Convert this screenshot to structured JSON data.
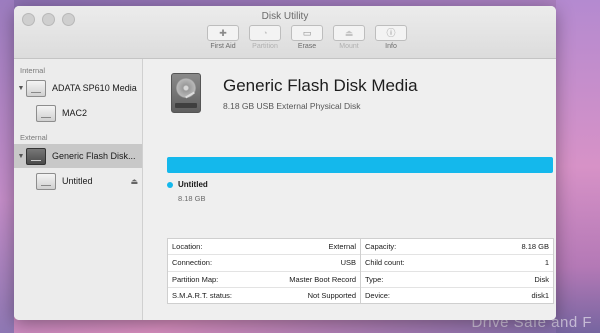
{
  "window": {
    "title": "Disk Utility"
  },
  "toolbar": [
    {
      "label": "First Aid",
      "icon": "stethoscope-icon",
      "glyph": "✚",
      "enabled": true
    },
    {
      "label": "Partition",
      "icon": "partition-icon",
      "glyph": "◔",
      "enabled": false
    },
    {
      "label": "Erase",
      "icon": "erase-icon",
      "glyph": "▭",
      "enabled": true
    },
    {
      "label": "Mount",
      "icon": "mount-icon",
      "glyph": "⏏",
      "enabled": false
    },
    {
      "label": "Info",
      "icon": "info-icon",
      "glyph": "ⓘ",
      "enabled": true
    }
  ],
  "sidebar": {
    "internal_label": "Internal",
    "external_label": "External",
    "internal_disk": "ADATA SP610 Media",
    "internal_volume": "MAC2",
    "external_disk": "Generic Flash Disk...",
    "external_volume": "Untitled"
  },
  "detail": {
    "title": "Generic Flash Disk Media",
    "subtitle": "8.18 GB USB External Physical Disk",
    "partition_name": "Untitled",
    "partition_size": "8.18 GB",
    "bar_color": "#14b8ec"
  },
  "info": {
    "left": [
      {
        "label": "Location:",
        "value": "External"
      },
      {
        "label": "Connection:",
        "value": "USB"
      },
      {
        "label": "Partition Map:",
        "value": "Master Boot Record"
      },
      {
        "label": "S.M.A.R.T. status:",
        "value": "Not Supported"
      }
    ],
    "right": [
      {
        "label": "Capacity:",
        "value": "8.18 GB"
      },
      {
        "label": "Child count:",
        "value": "1"
      },
      {
        "label": "Type:",
        "value": "Disk"
      },
      {
        "label": "Device:",
        "value": "disk1"
      }
    ]
  },
  "watermark": "Drive Safe and F"
}
